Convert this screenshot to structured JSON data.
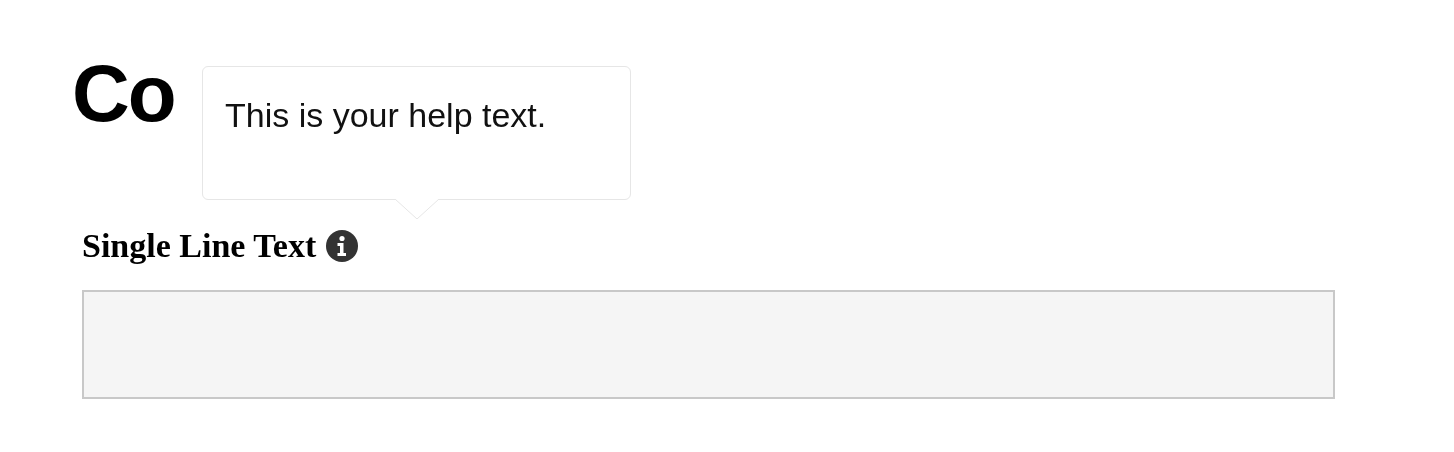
{
  "heading": "Co",
  "field": {
    "label": "Single Line Text",
    "help_tooltip": "This is your help text."
  }
}
